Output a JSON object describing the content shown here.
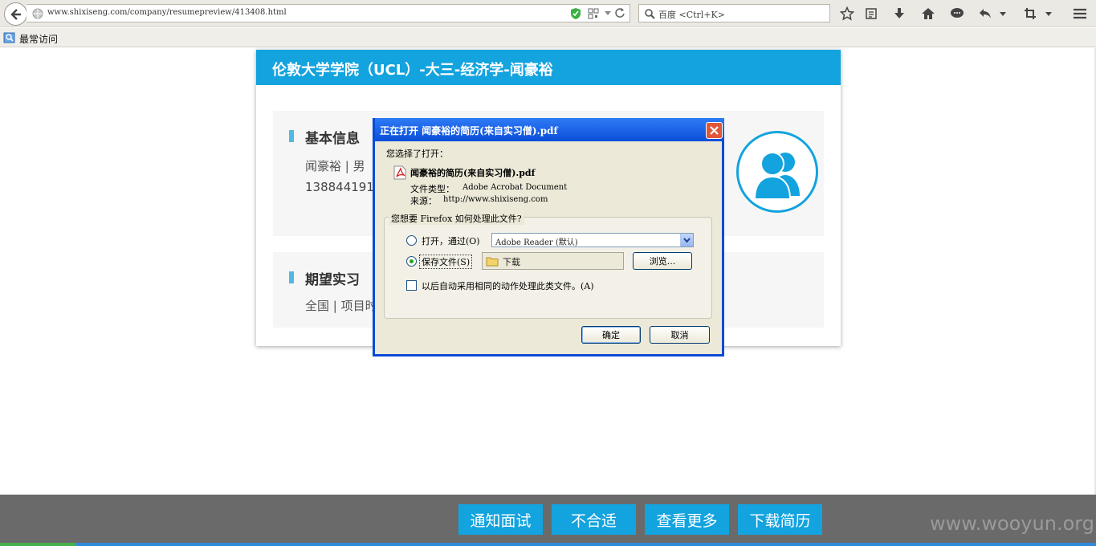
{
  "browser": {
    "url": "www.shixiseng.com/company/resumepreview/413408.html",
    "search_placeholder": "百度 <Ctrl+K>",
    "bookmarks_label": "最常访问"
  },
  "resume": {
    "title": "伦敦大学学院（UCL）-大三-经济学-闻豪裕",
    "basic_info": {
      "heading": "基本信息",
      "line1": "闻豪裕 | 男",
      "line2": "13884419125"
    },
    "expectation": {
      "heading": "期望实习",
      "line1": "全国 | 项目时"
    }
  },
  "dialog": {
    "title": "正在打开 闻豪裕的简历(来自实习僧).pdf",
    "chosen_label": "您选择了打开：",
    "file_name": "闻豪裕的简历(来自实习僧).pdf",
    "file_type_label": "文件类型：",
    "file_type": "Adobe Acrobat Document",
    "source_label": "来源：",
    "source": "http://www.shixiseng.com",
    "question": "您想要 Firefox 如何处理此文件?",
    "open_with_label": "打开，通过(O)",
    "open_with_app": "Adobe Reader  (默认)",
    "save_file_label": "保存文件(S)",
    "save_folder": "下载",
    "browse_label": "浏览...",
    "auto_label": "以后自动采用相同的动作处理此类文件。(A)",
    "ok_label": "确定",
    "cancel_label": "取消",
    "selected_option": "save_file",
    "auto_checked": false
  },
  "bottom_bar": {
    "buttons": [
      "通知面试",
      "不合适",
      "查看更多",
      "下载简历"
    ],
    "watermark": "www.wooyun.org"
  },
  "colors": {
    "accent": "#13a3de",
    "dialog_title": "#0a4ed9"
  }
}
